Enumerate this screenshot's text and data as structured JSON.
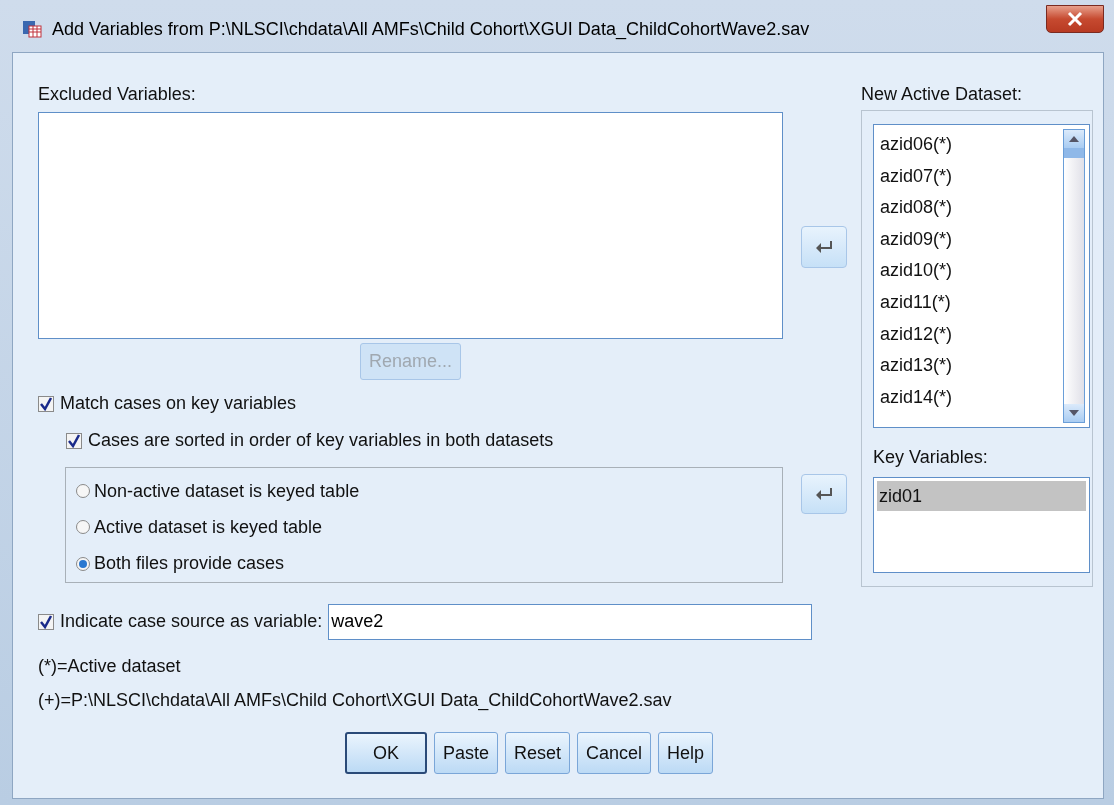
{
  "window": {
    "title": "Add Variables from P:\\NLSCI\\chdata\\All AMFs\\Child Cohort\\XGUI Data_ChildCohortWave2.sav"
  },
  "excluded_variables": {
    "label": "Excluded Variables:"
  },
  "rename_button": {
    "label": "Rename...",
    "disabled": true
  },
  "match_cases": {
    "label": "Match cases on key variables",
    "checked": true
  },
  "cases_sorted": {
    "label": "Cases are sorted in order of key variables in both datasets",
    "checked": true
  },
  "key_options": [
    {
      "label": "Non-active dataset is keyed table",
      "selected": false
    },
    {
      "label": "Active dataset is keyed table",
      "selected": false
    },
    {
      "label": "Both files provide cases",
      "selected": true
    }
  ],
  "new_active_dataset": {
    "label": "New Active Dataset:",
    "items": [
      "azid06(*)",
      "azid07(*)",
      "azid08(*)",
      "azid09(*)",
      "azid10(*)",
      "azid11(*)",
      "azid12(*)",
      "azid13(*)",
      "azid14(*)"
    ]
  },
  "key_variables": {
    "label": "Key Variables:",
    "items": [
      {
        "text": "zid01",
        "selected": true
      }
    ]
  },
  "case_source": {
    "label": "Indicate case source as variable:",
    "checked": true,
    "value": "wave2"
  },
  "notes": [
    "(*)=Active dataset",
    "(+)=P:\\NLSCI\\chdata\\All AMFs\\Child Cohort\\XGUI Data_ChildCohortWave2.sav"
  ],
  "buttons": [
    {
      "label": "OK",
      "default": true
    },
    {
      "label": "Paste",
      "default": false
    },
    {
      "label": "Reset",
      "default": false
    },
    {
      "label": "Cancel",
      "default": false
    },
    {
      "label": "Help",
      "default": false
    }
  ]
}
